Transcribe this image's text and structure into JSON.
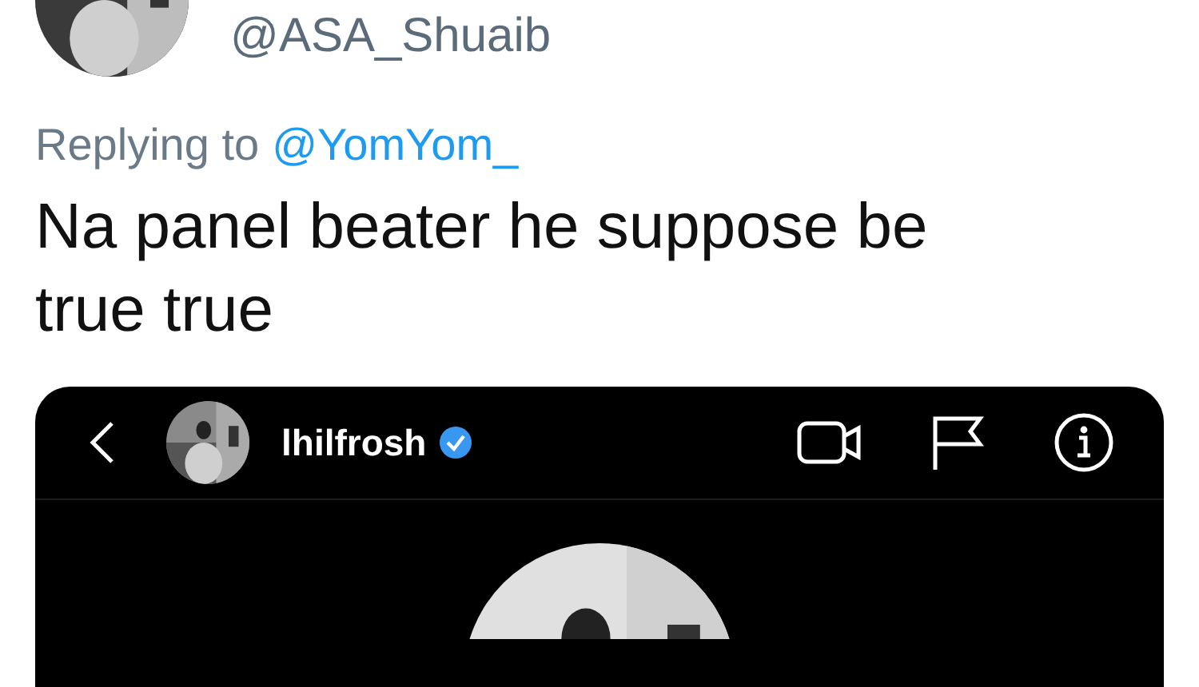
{
  "tweet": {
    "handle": "@ASA_Shuaib",
    "replying_prefix": "Replying to",
    "replying_to": "@YomYom_",
    "text": "Na panel beater he suppose be true true"
  },
  "embedded_screenshot": {
    "username": "lhilfrosh",
    "verified": true
  }
}
